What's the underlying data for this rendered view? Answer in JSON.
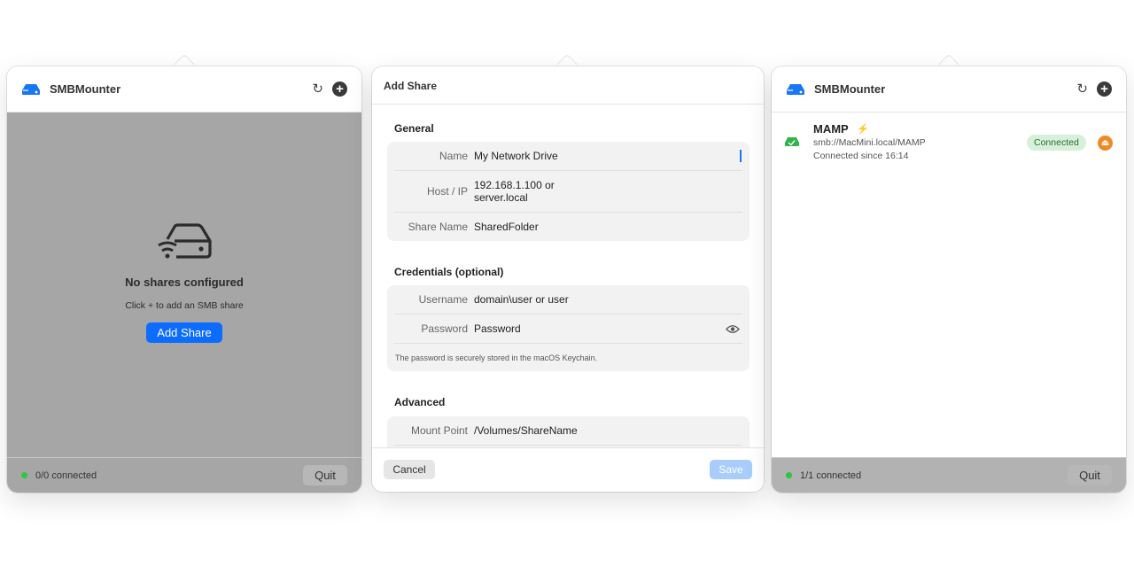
{
  "panel_empty": {
    "app_title": "SMBMounter",
    "empty_title": "No shares configured",
    "empty_subtitle": "Click + to add an SMB share",
    "add_share_button": "Add Share",
    "status": "0/0 connected",
    "quit": "Quit"
  },
  "panel_add": {
    "title": "Add Share",
    "general": {
      "heading": "General",
      "name_label": "Name",
      "name_placeholder": "My Network Drive",
      "host_label": "Host / IP",
      "host_placeholder_line1": "192.168.1.100 or",
      "host_placeholder_line2": "server.local",
      "share_label": "Share Name",
      "share_placeholder": "SharedFolder"
    },
    "credentials": {
      "heading": "Credentials (optional)",
      "username_label": "Username",
      "username_placeholder": "domain\\user or user",
      "password_label": "Password",
      "password_placeholder": "Password",
      "hint": "The password is securely stored in the macOS Keychain."
    },
    "advanced": {
      "heading": "Advanced",
      "mount_label": "Mount Point",
      "mount_placeholder": "/Volumes/ShareName"
    },
    "cancel": "Cancel",
    "save": "Save"
  },
  "panel_connected": {
    "app_title": "SMBMounter",
    "share": {
      "name": "MAMP",
      "url": "smb://MacMini.local/MAMP",
      "since": "Connected since 16:14",
      "status": "Connected"
    },
    "status": "1/1 connected",
    "quit": "Quit"
  },
  "icons": {
    "app": "smb-drive-icon",
    "refresh": "refresh-icon",
    "add": "plus-circle-icon",
    "bolt": "bolt-icon",
    "eject": "eject-icon",
    "eye": "eye-icon"
  },
  "colors": {
    "accent": "#0b6cff",
    "connected": "#28c840",
    "eject": "#f08a24"
  }
}
